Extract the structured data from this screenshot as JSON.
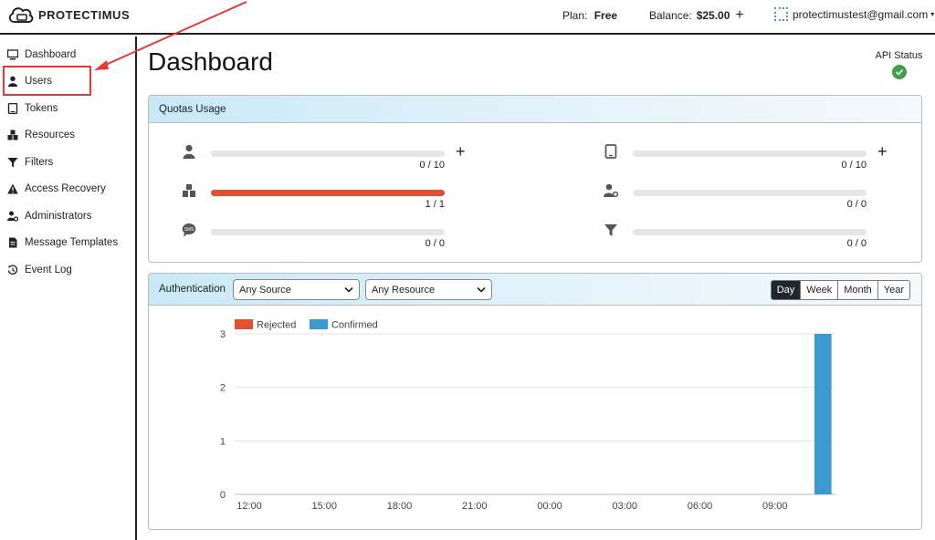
{
  "header": {
    "logo_text": "PROTECTIMUS",
    "plan_label": "Plan:",
    "plan_value": "Free",
    "balance_label": "Balance:",
    "balance_value": "$25.00",
    "add_balance": "+",
    "account_email": "protectimustest@gmail.com",
    "account_caret": "▾"
  },
  "sidebar": {
    "items": [
      {
        "label": "Dashboard",
        "icon": "monitor-icon"
      },
      {
        "label": "Users",
        "icon": "user-icon"
      },
      {
        "label": "Tokens",
        "icon": "tablet-icon"
      },
      {
        "label": "Resources",
        "icon": "cubes-icon"
      },
      {
        "label": "Filters",
        "icon": "filter-icon"
      },
      {
        "label": "Access Recovery",
        "icon": "warning-icon"
      },
      {
        "label": "Administrators",
        "icon": "user-gear-icon"
      },
      {
        "label": "Message Templates",
        "icon": "document-icon"
      },
      {
        "label": "Event Log",
        "icon": "history-icon"
      }
    ],
    "highlighted_item": "Users",
    "annotation_color": "#e53935"
  },
  "main": {
    "title": "Dashboard",
    "api_status_label": "API Status",
    "api_status_color": "#3fa045"
  },
  "quotas": {
    "title": "Quotas Usage",
    "items": [
      {
        "name": "users",
        "icon": "user-icon",
        "value": "0 / 10",
        "fraction": 0,
        "has_add": true
      },
      {
        "name": "tokens",
        "icon": "tablet-icon",
        "value": "0 / 10",
        "fraction": 0,
        "has_add": true
      },
      {
        "name": "resources",
        "icon": "cubes-icon",
        "value": "1 / 1",
        "fraction": 1,
        "has_add": false
      },
      {
        "name": "administrators",
        "icon": "user-gear-icon",
        "value": "0 / 0",
        "fraction": 0,
        "has_add": false
      },
      {
        "name": "sms",
        "icon": "sms-icon",
        "value": "0 / 0",
        "fraction": 0,
        "has_add": false
      },
      {
        "name": "filters",
        "icon": "filter-icon",
        "value": "0 / 0",
        "fraction": 0,
        "has_add": false
      }
    ],
    "add_label": "+",
    "fill_color": "#e0522e"
  },
  "authentication": {
    "title": "Authentication",
    "source_select": "Any Source",
    "resource_select": "Any Resource",
    "periods": [
      "Day",
      "Week",
      "Month",
      "Year"
    ],
    "selected_period": "Day"
  },
  "chart_data": {
    "type": "bar",
    "series": [
      {
        "name": "Rejected",
        "color": "#e0522e",
        "values": [
          0,
          0,
          0,
          0,
          0,
          0,
          0,
          0,
          0,
          0,
          0,
          0,
          0,
          0,
          0,
          0,
          0,
          0,
          0,
          0,
          0,
          0,
          0,
          0
        ]
      },
      {
        "name": "Confirmed",
        "color": "#3d9ad1",
        "values": [
          0,
          0,
          0,
          0,
          0,
          0,
          0,
          0,
          0,
          0,
          0,
          0,
          0,
          0,
          0,
          0,
          0,
          0,
          0,
          0,
          0,
          0,
          0,
          3
        ]
      }
    ],
    "x_tick_labels": [
      "12:00",
      "15:00",
      "18:00",
      "21:00",
      "00:00",
      "03:00",
      "06:00",
      "09:00"
    ],
    "y_ticks": [
      0,
      1,
      2,
      3
    ],
    "ylim": [
      0,
      3
    ],
    "legend_position": "top-left",
    "grid": true
  }
}
